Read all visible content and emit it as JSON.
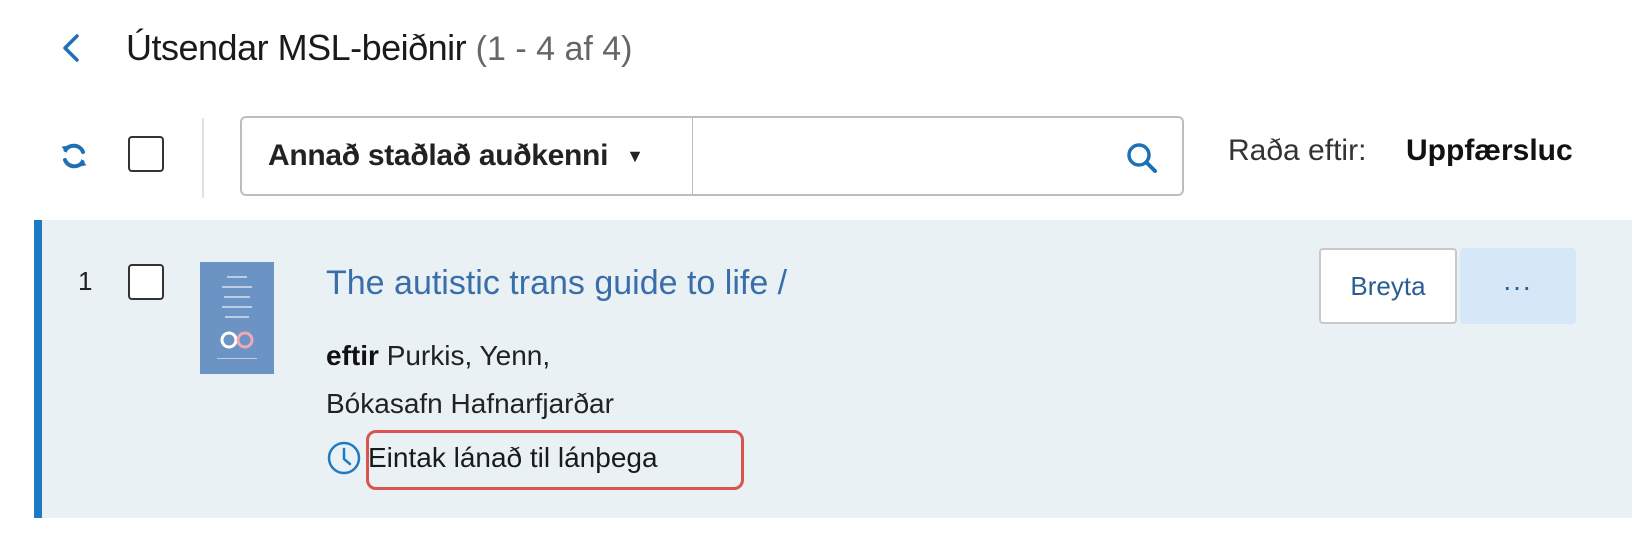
{
  "header": {
    "back_icon": "chevron-left-icon",
    "title": "Útsendar MSL-beiðnir",
    "count": "(1 - 4 af 4)"
  },
  "toolbar": {
    "refresh_icon": "refresh-icon",
    "search_field_label": "Annað staðlað auðkenni",
    "search_value": "",
    "search_icon": "search-icon",
    "sort_label": "Raða eftir:",
    "sort_value": "Uppfærsluc"
  },
  "results": [
    {
      "index": "1",
      "title": "The autistic trans guide to life /",
      "author_prefix": "eftir",
      "author": "Purkis, Yenn,",
      "library": "Bókasafn Hafnarfjarðar",
      "status": "Eintak lánað til lánþega",
      "edit_label": "Breyta",
      "more_label": "...",
      "status_icon": "clock-icon"
    }
  ],
  "colors": {
    "accent": "#1f7bc1",
    "link": "#3a6ea8",
    "row_bg": "#eaf1f5",
    "highlight": "#d9534f"
  }
}
